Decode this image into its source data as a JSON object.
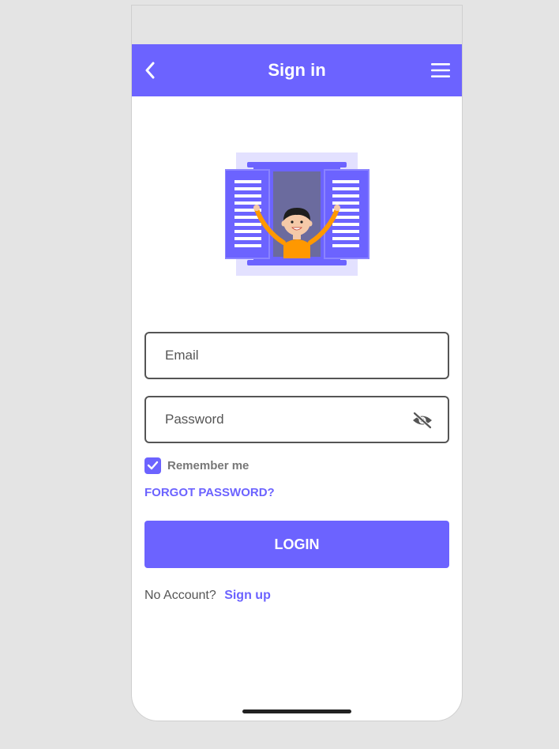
{
  "header": {
    "title": "Sign in",
    "back_icon": "chevron-left-icon",
    "menu_icon": "hamburger-menu-icon"
  },
  "illustration": {
    "name": "person-waving-from-window-illustration"
  },
  "form": {
    "email_placeholder": "Email",
    "email_value": "",
    "password_placeholder": "Password",
    "password_value": "",
    "password_toggle_icon": "eye-slash-icon",
    "remember_label": "Remember me",
    "remember_checked": true,
    "forgot_label": "FORGOT PASSWORD?",
    "login_label": "LOGIN"
  },
  "footer": {
    "no_account_text": "No Account?",
    "signup_label": "Sign up"
  },
  "colors": {
    "accent": "#6c63ff",
    "accent_light": "#e3e1ff",
    "skin": "#f5c9a8",
    "shirt": "#ff9800",
    "hair": "#1e1e1e",
    "background": "#e4e4e4"
  }
}
